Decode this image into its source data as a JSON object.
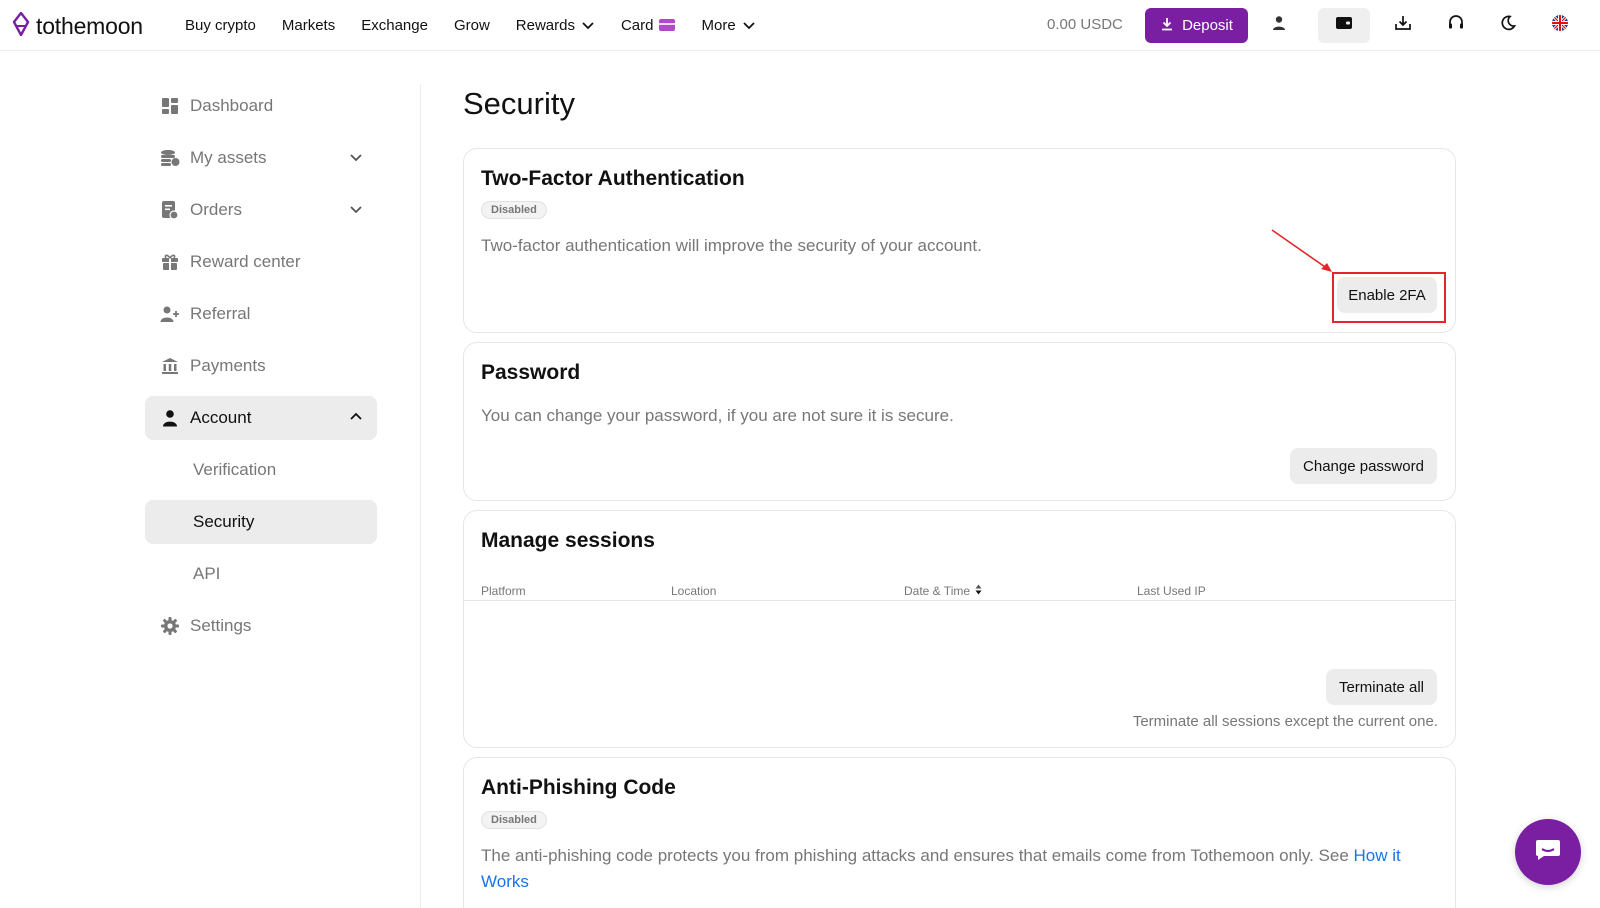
{
  "brand": {
    "name": "tothemoon",
    "accent": "#7a1fa2"
  },
  "nav": {
    "items": [
      {
        "label": "Buy crypto"
      },
      {
        "label": "Markets"
      },
      {
        "label": "Exchange"
      },
      {
        "label": "Grow"
      },
      {
        "label": "Rewards"
      },
      {
        "label": "Card"
      },
      {
        "label": "More"
      }
    ],
    "balance": "0.00 USDC",
    "deposit_label": "Deposit"
  },
  "sidebar": {
    "items": [
      {
        "label": "Dashboard",
        "icon": "dashboard-icon"
      },
      {
        "label": "My assets",
        "icon": "coins-icon"
      },
      {
        "label": "Orders",
        "icon": "orders-icon"
      },
      {
        "label": "Reward center",
        "icon": "gift-icon"
      },
      {
        "label": "Referral",
        "icon": "add-user-icon"
      },
      {
        "label": "Payments",
        "icon": "bank-icon"
      },
      {
        "label": "Account",
        "icon": "user-icon"
      },
      {
        "label": "Settings",
        "icon": "gear-icon"
      }
    ],
    "account_sub": [
      {
        "label": "Verification"
      },
      {
        "label": "Security"
      },
      {
        "label": "API"
      }
    ]
  },
  "page": {
    "title": "Security"
  },
  "two_factor": {
    "title": "Two-Factor Authentication",
    "status": "Disabled",
    "description": "Two-factor authentication will improve the security of your account.",
    "button": "Enable 2FA"
  },
  "password": {
    "title": "Password",
    "description": "You can change your password, if you are not sure it is secure.",
    "button": "Change password"
  },
  "sessions": {
    "title": "Manage sessions",
    "columns": [
      "Platform",
      "Location",
      "Date & Time",
      "Last Used IP"
    ],
    "button": "Terminate all",
    "note": "Terminate all sessions except the current one."
  },
  "anti_phishing": {
    "title": "Anti-Phishing Code",
    "status": "Disabled",
    "description": "The anti-phishing code protects you from phishing attacks and ensures that emails come from Tothemoon only. See ",
    "link": "How it Works"
  }
}
